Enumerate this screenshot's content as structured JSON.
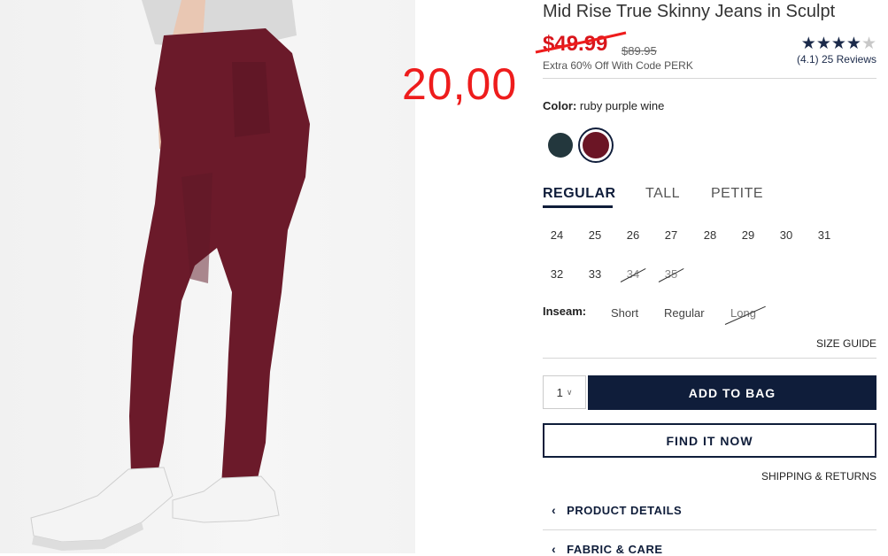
{
  "product": {
    "title": "Mid Rise True Skinny Jeans in Sculpt",
    "sale_price": "$49.99",
    "original_price": "$89.95",
    "promo": "Extra 60% Off With Code PERK",
    "rating_stars": 4.1,
    "reviews_text": "(4.1) 25 Reviews"
  },
  "annotation": {
    "handwritten_price": "20,00",
    "color": "#ee1c1c"
  },
  "color": {
    "label": "Color:",
    "value": "ruby purple wine",
    "swatches": [
      {
        "name": "dark-teal",
        "hex": "#23373d"
      },
      {
        "name": "ruby-purple-wine",
        "hex": "#6b1525",
        "selected": true
      }
    ]
  },
  "fit_tabs": [
    {
      "label": "REGULAR",
      "active": true
    },
    {
      "label": "TALL"
    },
    {
      "label": "PETITE"
    }
  ],
  "sizes": [
    {
      "label": "24"
    },
    {
      "label": "25"
    },
    {
      "label": "26"
    },
    {
      "label": "27"
    },
    {
      "label": "28"
    },
    {
      "label": "29"
    },
    {
      "label": "30"
    },
    {
      "label": "31"
    },
    {
      "label": "32"
    },
    {
      "label": "33"
    },
    {
      "label": "34",
      "out_of_stock": true
    },
    {
      "label": "35",
      "out_of_stock": true
    }
  ],
  "inseam": {
    "label": "Inseam:",
    "options": [
      {
        "label": "Short"
      },
      {
        "label": "Regular"
      },
      {
        "label": "Long",
        "out_of_stock": true
      }
    ]
  },
  "size_guide": "SIZE GUIDE",
  "quantity": {
    "value": "1"
  },
  "buttons": {
    "add_to_bag": "ADD TO BAG",
    "find_it_now": "FIND IT NOW"
  },
  "shipping_returns": "SHIPPING & RETURNS",
  "accordions": [
    "PRODUCT DETAILS",
    "FABRIC & CARE"
  ],
  "colors": {
    "navy": "#0f1d3a",
    "sale_red": "#d9151b"
  }
}
